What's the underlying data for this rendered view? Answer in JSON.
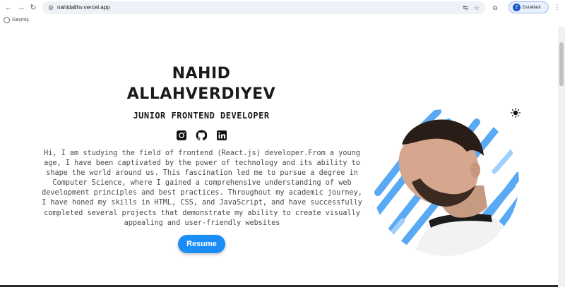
{
  "browser": {
    "url": "nahidallhv.vercel.app",
    "profile_initial": "2",
    "profile_label": "Durakladı"
  },
  "bookmarks": {
    "history_label": "Geçmiş"
  },
  "hero": {
    "name_line1": "NAHID",
    "name_line2": "ALLAHVERDIYEV",
    "role": "JUNIOR FRONTEND DEVELOPER",
    "bio": [
      "Hi, I am studying the field of frontend (React.js) developer.From a young",
      "age, I have been captivated by the power of technology and its ability to",
      "shape the world around us. This fascination led me to pursue a degree in",
      "Computer Science, where I gained a comprehensive understanding of web",
      "development principles and best practices. Throughout my academic journey,",
      "I have honed my skills in HTML, CSS, and JavaScript, and have successfully",
      "completed several projects that demonstrate my ability to create visually",
      "appealing and user-friendly websites"
    ],
    "resume_label": "Resume"
  },
  "socials": [
    {
      "icon": "instagram-icon"
    },
    {
      "icon": "github-icon"
    },
    {
      "icon": "linkedin-icon"
    }
  ],
  "colors": {
    "accent": "#1a8df7",
    "stripe_blue": "#5aa9f5",
    "text_dark": "#1b1b1b",
    "text_body": "#4a4a4a"
  }
}
